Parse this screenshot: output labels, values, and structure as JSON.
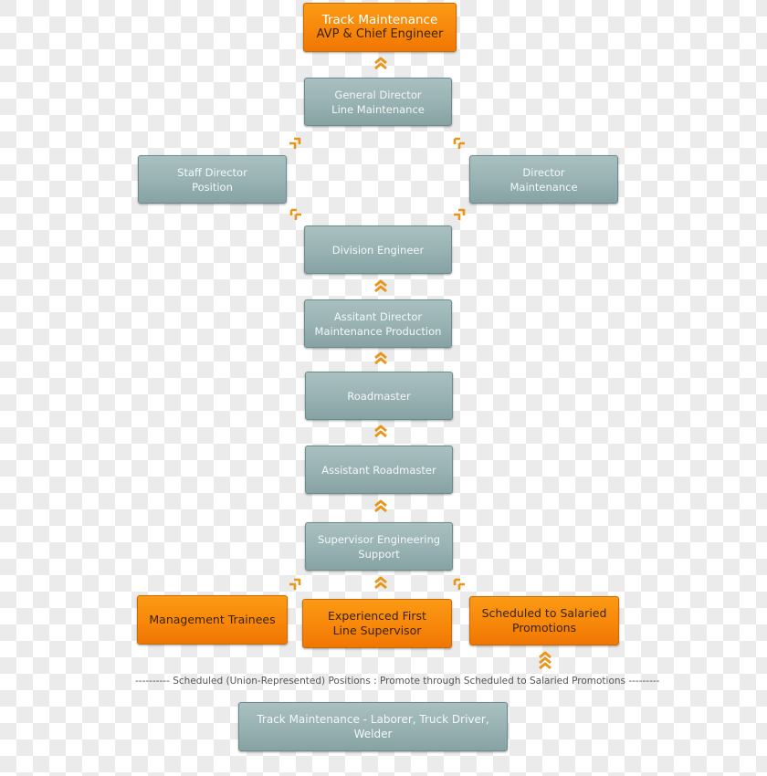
{
  "colors": {
    "orange": "#f7870a",
    "gray_box": "#98b1b2",
    "arrow": "#f0a020",
    "checker": "#ebebeb"
  },
  "nodes": {
    "top": {
      "line1": "Track Maintenance",
      "line2": "AVP & Chief Engineer"
    },
    "general_director": {
      "line1": "General Director",
      "line2": "Line Maintenance"
    },
    "staff_director": {
      "line1": "Staff Director",
      "line2": "Position"
    },
    "director_maintenance": {
      "line1": "Director",
      "line2": "Maintenance"
    },
    "division_engineer": {
      "line1": "Division Engineer"
    },
    "assistant_director": {
      "line1": "Assitant Director",
      "line2": "Maintenance Production"
    },
    "roadmaster": {
      "line1": "Roadmaster"
    },
    "assistant_roadmaster": {
      "line1": "Assistant Roadmaster"
    },
    "supervisor_engineering": {
      "line1": "Supervisor Engineering",
      "line2": "Support"
    },
    "management_trainees": {
      "line1": "Management Trainees"
    },
    "experienced_supervisor": {
      "line1": "Experienced First",
      "line2": "Line Supervisor"
    },
    "scheduled_promotions": {
      "line1": "Scheduled to Salaried",
      "line2": "Promotions"
    },
    "track_laborer": {
      "line1": "Track Maintenance - Laborer, Truck Driver, Welder"
    }
  },
  "separator_text": "---------- Scheduled (Union-Represented) Positions : Promote through Scheduled to Salaried Promotions ---------",
  "arrows": {
    "icon": "double-chevron-up-icon",
    "triple_icon": "triple-chevron-up-icon"
  }
}
